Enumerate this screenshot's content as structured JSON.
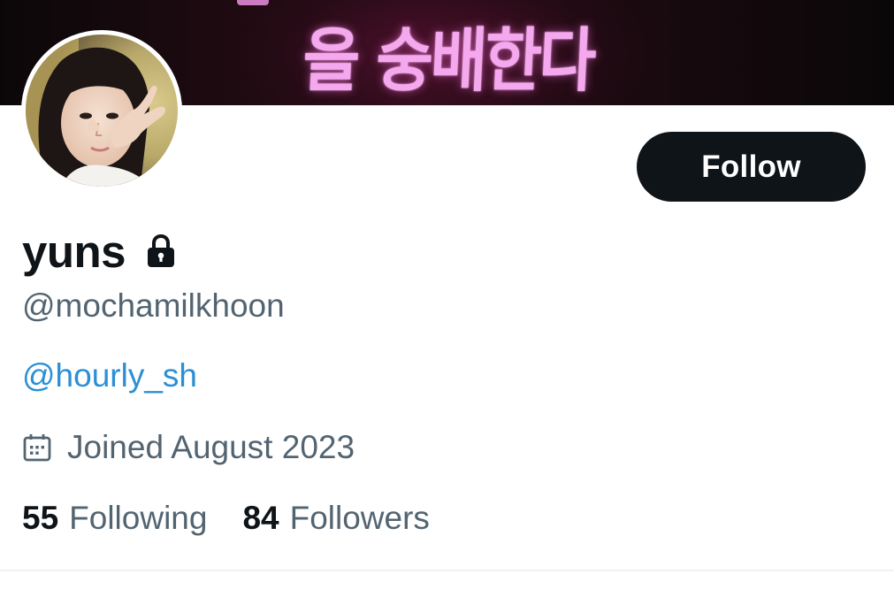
{
  "banner": {
    "text": "을 숭배한다"
  },
  "profile": {
    "display_name": "yuns",
    "handle": "@mochamilkhoon",
    "bio_link": "@hourly_sh",
    "joined": "Joined August 2023",
    "protected_icon": "lock-icon",
    "calendar_icon": "calendar-icon"
  },
  "actions": {
    "follow_label": "Follow"
  },
  "stats": {
    "following_count": "55",
    "following_label": "Following",
    "followers_count": "84",
    "followers_label": "Followers"
  },
  "colors": {
    "primary_text": "#0f1419",
    "secondary_text": "#536471",
    "link": "#1d9bf0",
    "button_bg": "#0f1419",
    "banner_text": "#f4a9ee"
  }
}
